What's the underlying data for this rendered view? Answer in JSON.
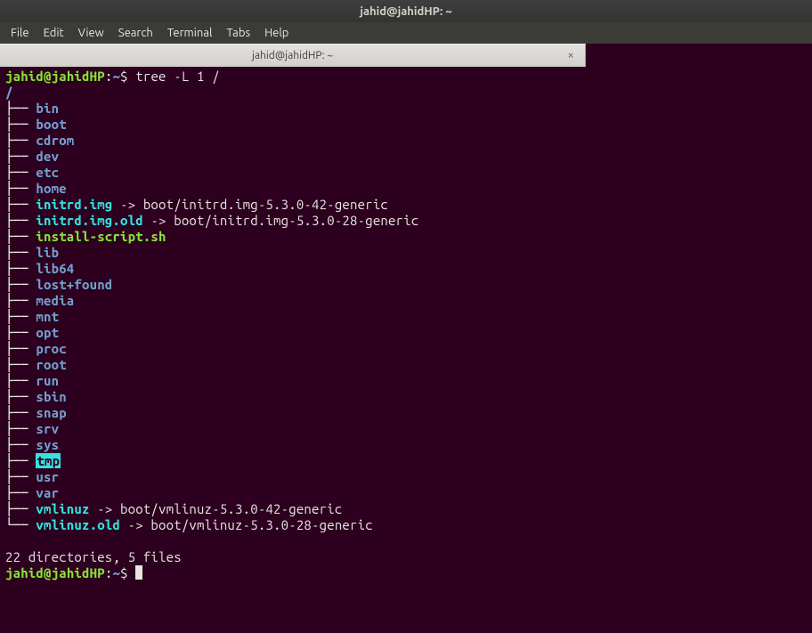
{
  "window": {
    "title": "jahid@jahidHP: ~"
  },
  "menu": {
    "file": "File",
    "edit": "Edit",
    "view": "View",
    "search": "Search",
    "terminal": "Terminal",
    "tabs": "Tabs",
    "help": "Help"
  },
  "tab": {
    "label": "jahid@jahidHP: ~",
    "close_glyph": "×"
  },
  "prompt": {
    "user": "jahid",
    "at": "@",
    "host": "jahidHP",
    "colon": ":",
    "cwd": "~",
    "sigil": "$"
  },
  "command": "tree -L 1 /",
  "root": "/",
  "tree_branch": "├── ",
  "tree_last": "└── ",
  "entries": [
    {
      "kind": "dir",
      "name": "bin"
    },
    {
      "kind": "dir",
      "name": "boot"
    },
    {
      "kind": "dir",
      "name": "cdrom"
    },
    {
      "kind": "dir",
      "name": "dev"
    },
    {
      "kind": "dir",
      "name": "etc"
    },
    {
      "kind": "dir",
      "name": "home"
    },
    {
      "kind": "link",
      "name": "initrd.img",
      "target": "boot/initrd.img-5.3.0-42-generic"
    },
    {
      "kind": "link",
      "name": "initrd.img.old",
      "target": "boot/initrd.img-5.3.0-28-generic"
    },
    {
      "kind": "file",
      "name": "install-script.sh"
    },
    {
      "kind": "dir",
      "name": "lib"
    },
    {
      "kind": "dir",
      "name": "lib64"
    },
    {
      "kind": "dir",
      "name": "lost+found"
    },
    {
      "kind": "dir",
      "name": "media"
    },
    {
      "kind": "dir",
      "name": "mnt"
    },
    {
      "kind": "dir",
      "name": "opt"
    },
    {
      "kind": "dir",
      "name": "proc"
    },
    {
      "kind": "dir",
      "name": "root"
    },
    {
      "kind": "dir",
      "name": "run"
    },
    {
      "kind": "dir",
      "name": "sbin"
    },
    {
      "kind": "dir",
      "name": "snap"
    },
    {
      "kind": "dir",
      "name": "srv"
    },
    {
      "kind": "dir",
      "name": "sys"
    },
    {
      "kind": "hl",
      "name": "tmp"
    },
    {
      "kind": "dir",
      "name": "usr"
    },
    {
      "kind": "dir",
      "name": "var"
    },
    {
      "kind": "link",
      "name": "vmlinuz",
      "target": "boot/vmlinuz-5.3.0-42-generic"
    },
    {
      "kind": "link",
      "name": "vmlinuz.old",
      "target": "boot/vmlinuz-5.3.0-28-generic"
    }
  ],
  "arrow": " -> ",
  "summary": "22 directories, 5 files"
}
